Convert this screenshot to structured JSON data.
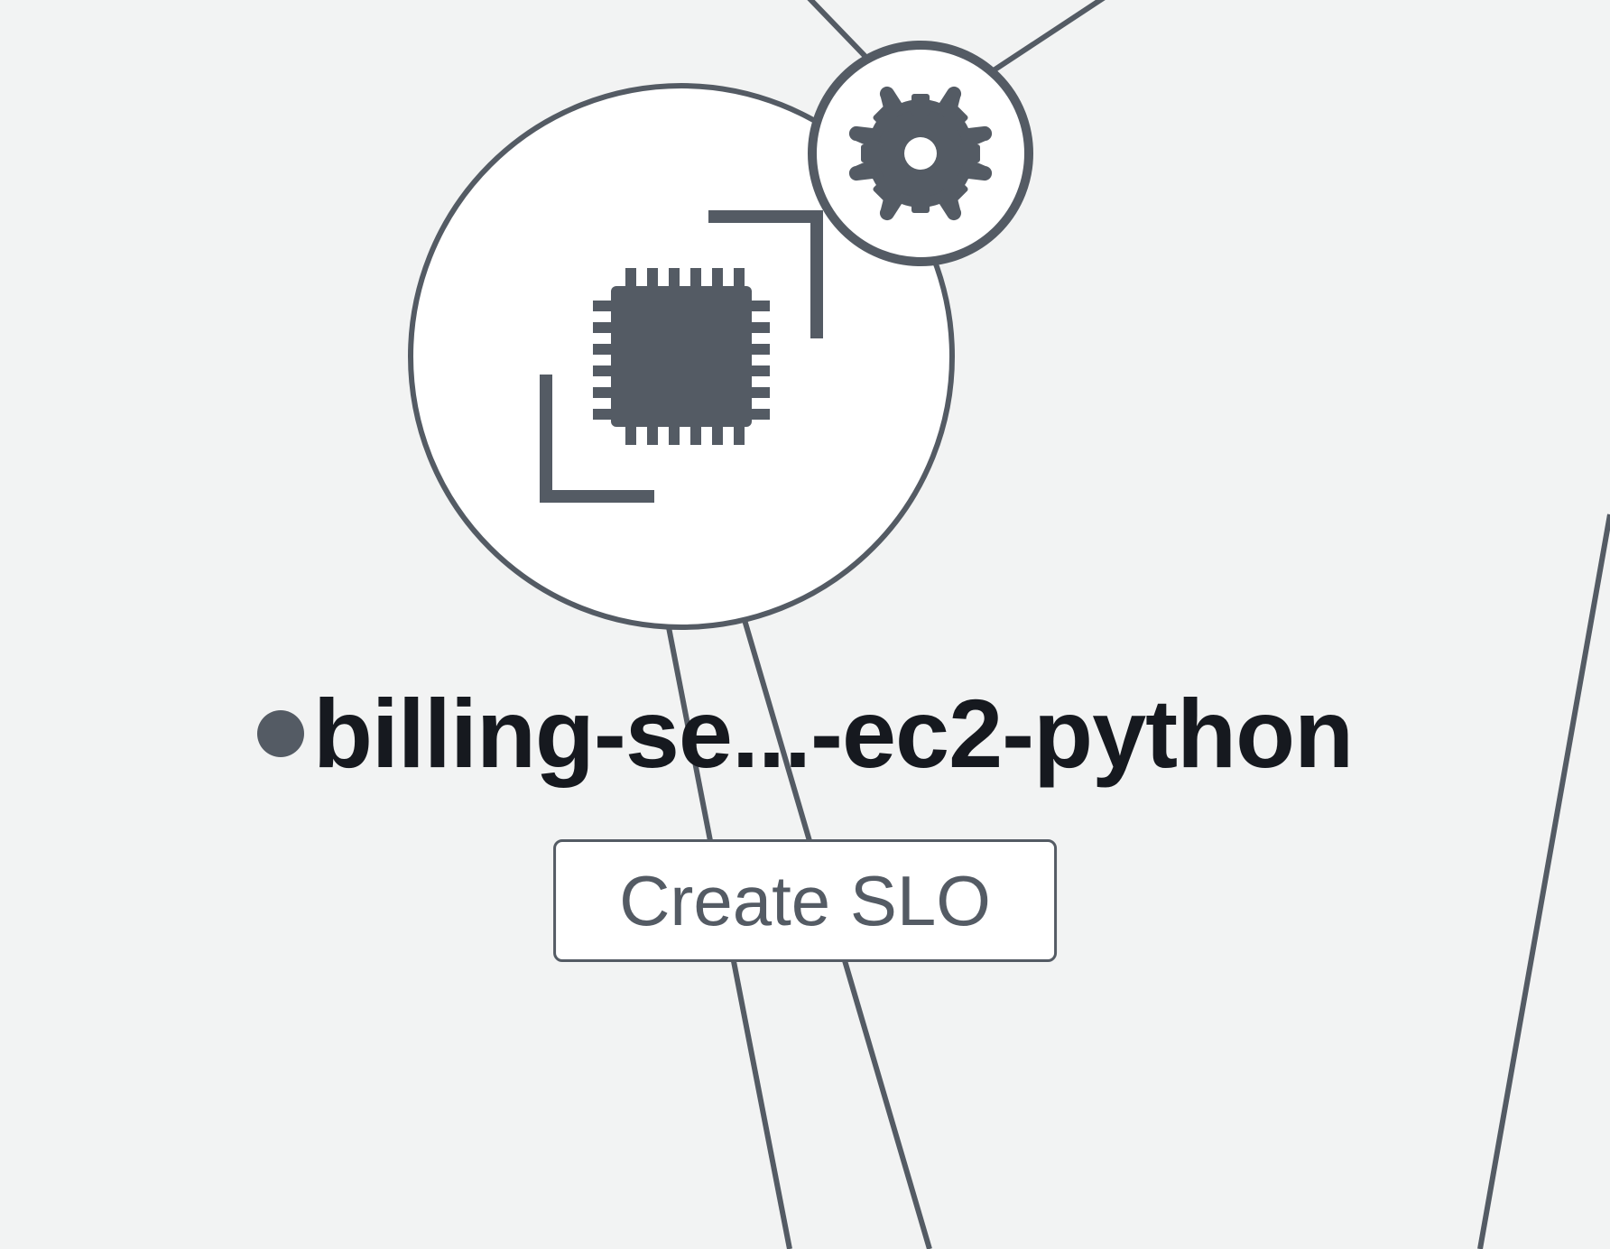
{
  "node": {
    "label": "billing-se...-ec2-python",
    "status_color": "#545b64",
    "icon": "cpu-icon",
    "badge_icon": "gear-icon"
  },
  "actions": {
    "create_slo_label": "Create SLO"
  },
  "colors": {
    "stroke": "#545b64",
    "background": "#f2f3f3",
    "white": "#ffffff",
    "text": "#16191f"
  }
}
